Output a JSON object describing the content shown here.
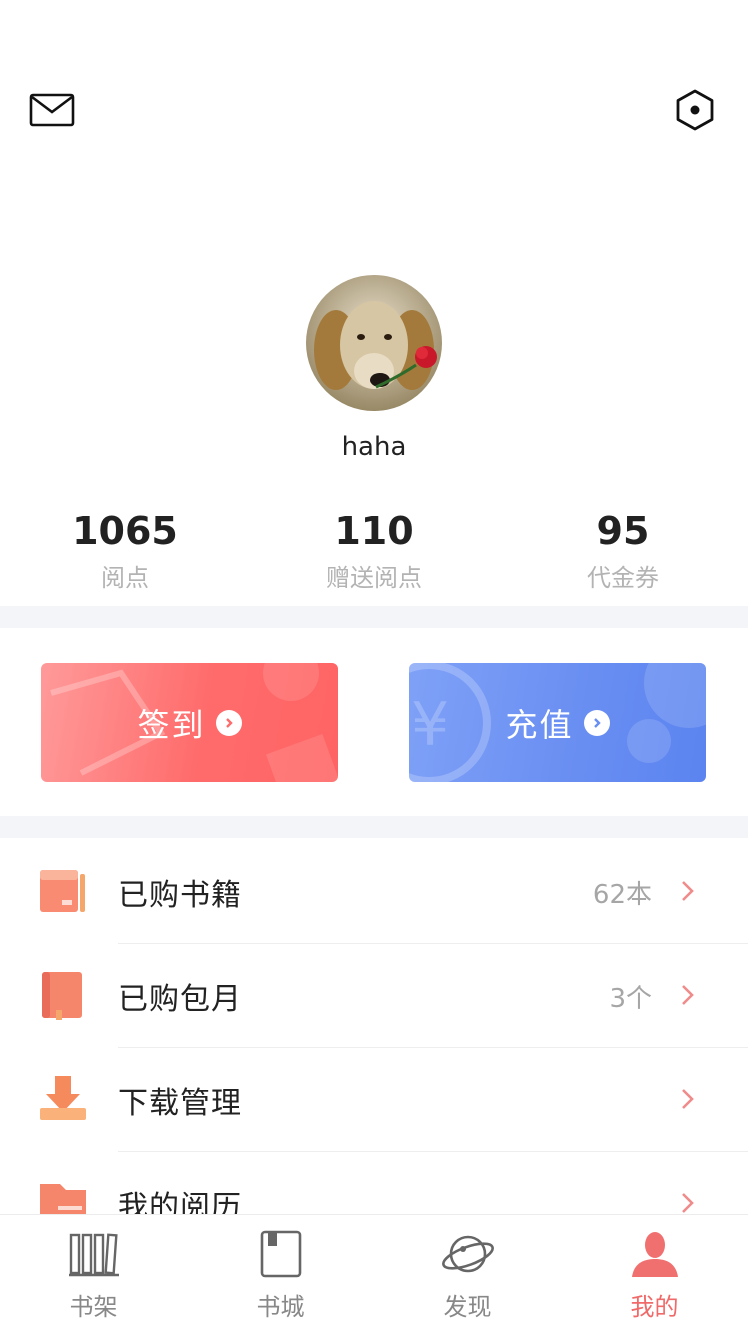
{
  "header": {
    "mail_icon": "mail-icon",
    "settings_icon": "settings-hexagon-icon"
  },
  "profile": {
    "username": "haha",
    "avatar": "dog-avatar"
  },
  "stats": [
    {
      "value": "1065",
      "label": "阅点"
    },
    {
      "value": "110",
      "label": "赠送阅点"
    },
    {
      "value": "95",
      "label": "代金券"
    }
  ],
  "actions": {
    "checkin_label": "签到",
    "recharge_label": "充值",
    "checkin_color": "#ff6b6b",
    "recharge_color": "#6a8ff2"
  },
  "menu": [
    {
      "label": "已购书籍",
      "value": "62本",
      "icon": "purchased-books-icon"
    },
    {
      "label": "已购包月",
      "value": "3个",
      "icon": "monthly-subscription-icon"
    },
    {
      "label": "下载管理",
      "value": "",
      "icon": "download-icon"
    },
    {
      "label": "我的阅历",
      "value": "",
      "icon": "reading-history-icon"
    }
  ],
  "tabs": [
    {
      "label": "书架",
      "icon": "bookshelf-icon"
    },
    {
      "label": "书城",
      "icon": "bookstore-icon"
    },
    {
      "label": "发现",
      "icon": "planet-icon"
    },
    {
      "label": "我的",
      "icon": "profile-icon",
      "active": true
    }
  ],
  "colors": {
    "accent": "#f06a6a",
    "muted_text": "#b3b3b3"
  }
}
